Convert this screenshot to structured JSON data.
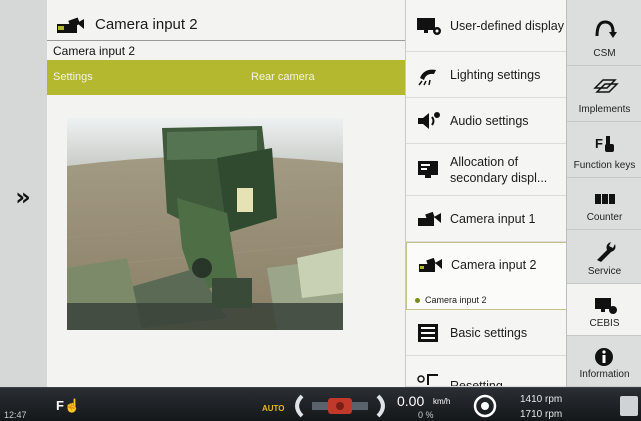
{
  "main": {
    "header_title": "Camera input 2",
    "subtitle": "Camera input 2",
    "bar_left": "Settings",
    "bar_right": "Rear camera"
  },
  "menu": {
    "items": [
      {
        "label": "User-defined display",
        "icon": "display-gear-icon"
      },
      {
        "label": "Lighting settings",
        "icon": "lighting-icon"
      },
      {
        "label": "Audio settings",
        "icon": "speaker-gear-icon"
      },
      {
        "label": "Allocation of secondary displ...",
        "icon": "monitor-icon"
      },
      {
        "label": "Camera input 1",
        "icon": "camera-icon"
      },
      {
        "label": "Camera input 2",
        "icon": "camera-icon",
        "note": "Camera input 2"
      },
      {
        "label": "Basic settings",
        "icon": "sliders-icon"
      },
      {
        "label": "Resetting",
        "icon": "reset-icon"
      }
    ]
  },
  "right_panel": {
    "items": [
      {
        "label": "CSM",
        "icon": "csm-arrow-icon"
      },
      {
        "label": "Implements",
        "icon": "implements-icon"
      },
      {
        "label": "Function keys",
        "icon": "function-key-icon"
      },
      {
        "label": "Counter",
        "icon": "counter-icon"
      },
      {
        "label": "Service",
        "icon": "wrench-icon"
      },
      {
        "label": "CEBIS",
        "icon": "cebis-icon"
      },
      {
        "label": "Information",
        "icon": "info-icon"
      }
    ]
  },
  "status": {
    "time": "12:47",
    "auto": "AUTO",
    "speed": "0.00",
    "speed_unit": "km/h",
    "slip": "0 %",
    "rpm_1": "1410 rpm",
    "rpm_2": "1710 rpm"
  },
  "colors": {
    "accent_green": "#b4b82e",
    "auto_yellow": "#e8b61e",
    "steer_red": "#c0392b"
  }
}
